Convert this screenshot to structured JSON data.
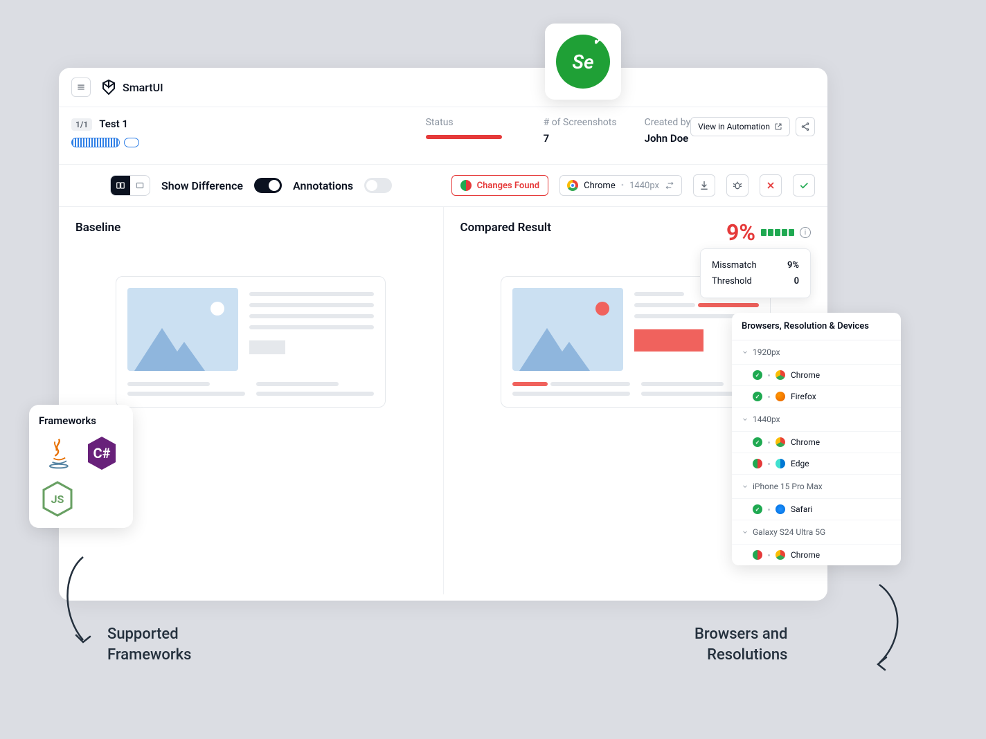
{
  "app": {
    "title": "SmartUI"
  },
  "header": {
    "test_badge": "1/1",
    "test_name": "Test 1",
    "status_label": "Status",
    "screenshots_label": "# of Screenshots",
    "screenshots_value": "7",
    "created_label": "Created by",
    "created_value": "John Doe",
    "view_automation": "View in Automation"
  },
  "toolbar": {
    "show_diff_label": "Show Difference",
    "annotations_label": "Annotations",
    "changes_found": "Changes Found",
    "browser": "Chrome",
    "resolution": "1440px"
  },
  "compare": {
    "baseline_title": "Baseline",
    "result_title": "Compared Result",
    "percent": "9%",
    "tooltip": {
      "mismatch_label": "Missmatch",
      "mismatch_value": "9%",
      "threshold_label": "Threshold",
      "threshold_value": "0"
    }
  },
  "frameworks": {
    "title": "Frameworks",
    "items": [
      "Java",
      "C#",
      "Node.js"
    ]
  },
  "browsers_panel": {
    "title": "Browsers, Resolution & Devices",
    "groups": [
      {
        "name": "1920px",
        "items": [
          {
            "status": "ok",
            "browser": "Chrome",
            "icon": "chrome"
          },
          {
            "status": "ok",
            "browser": "Firefox",
            "icon": "firefox"
          }
        ]
      },
      {
        "name": "1440px",
        "items": [
          {
            "status": "ok",
            "browser": "Chrome",
            "icon": "chrome"
          },
          {
            "status": "half",
            "browser": "Edge",
            "icon": "edge"
          }
        ]
      },
      {
        "name": "iPhone 15 Pro Max",
        "items": [
          {
            "status": "ok",
            "browser": "Safari",
            "icon": "safari"
          }
        ]
      },
      {
        "name": "Galaxy S24 Ultra 5G",
        "items": [
          {
            "status": "half",
            "browser": "Chrome",
            "icon": "chrome"
          }
        ]
      }
    ]
  },
  "captions": {
    "left_line1": "Supported",
    "left_line2": "Frameworks",
    "right_line1": "Browsers and",
    "right_line2": "Resolutions"
  },
  "selenium_badge": "Se"
}
